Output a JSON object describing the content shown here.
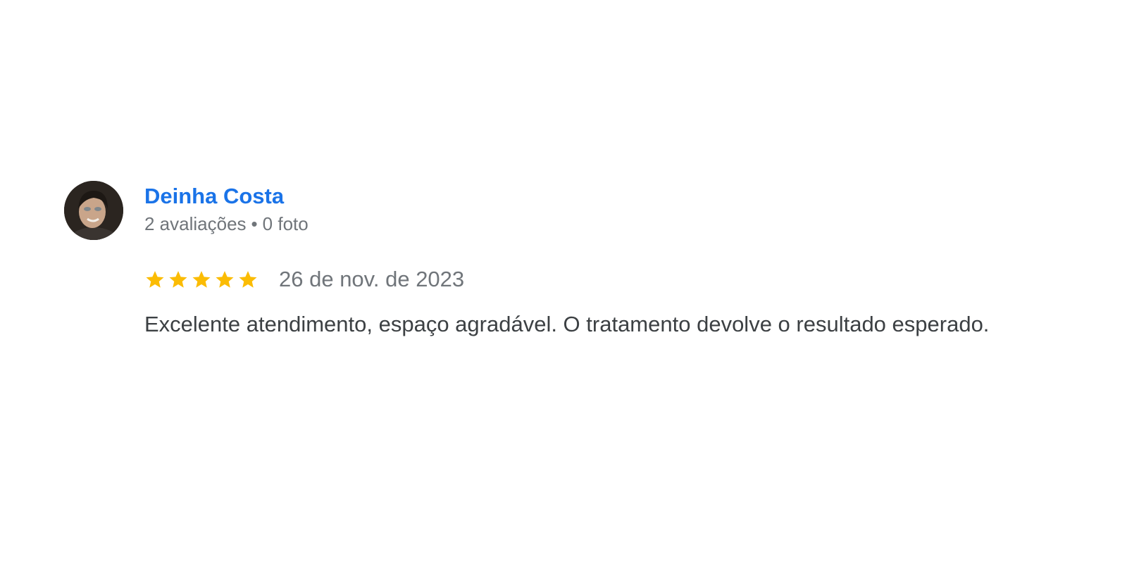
{
  "review": {
    "reviewer_name": "Deinha Costa",
    "reviews_count": "2 avaliações",
    "separator": "•",
    "photos_count": "0 foto",
    "rating": 5,
    "rating_max": 5,
    "star_color": "#fbbc04",
    "date": "26 de nov. de 2023",
    "text": "Excelente atendimento, espaço agradável. O tratamento devolve o resultado esperado."
  },
  "colors": {
    "name_link": "#1a73e8",
    "meta_text": "#70757a",
    "body_text": "#3c4043"
  }
}
